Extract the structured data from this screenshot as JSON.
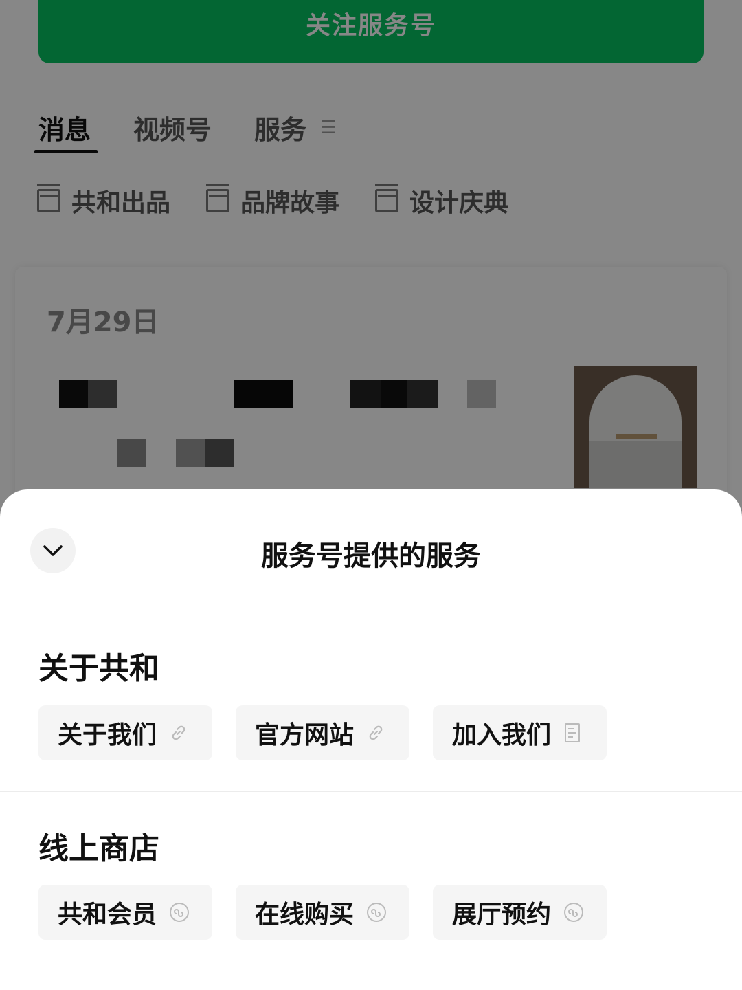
{
  "follow_button": {
    "label": "关注服务号",
    "color": "#07c160"
  },
  "tabs": [
    {
      "label": "消息",
      "active": true
    },
    {
      "label": "视频号",
      "active": false
    },
    {
      "label": "服务",
      "active": false,
      "icon": "menu-icon"
    }
  ],
  "subtabs": [
    {
      "label": "共和出品",
      "icon": "folder-icon"
    },
    {
      "label": "品牌故事",
      "icon": "folder-icon"
    },
    {
      "label": "设计庆典",
      "icon": "folder-icon"
    }
  ],
  "message_card": {
    "date": "7月29日"
  },
  "sheet": {
    "title": "服务号提供的服务",
    "collapse_icon": "chevron-down-icon",
    "sections": [
      {
        "title": "关于共和",
        "items": [
          {
            "label": "关于我们",
            "icon": "link-icon"
          },
          {
            "label": "官方网站",
            "icon": "link-icon"
          },
          {
            "label": "加入我们",
            "icon": "document-icon"
          }
        ]
      },
      {
        "title": "线上商店",
        "items": [
          {
            "label": "共和会员",
            "icon": "mini-program-icon"
          },
          {
            "label": "在线购买",
            "icon": "mini-program-icon"
          },
          {
            "label": "展厅预约",
            "icon": "mini-program-icon"
          }
        ]
      }
    ]
  }
}
